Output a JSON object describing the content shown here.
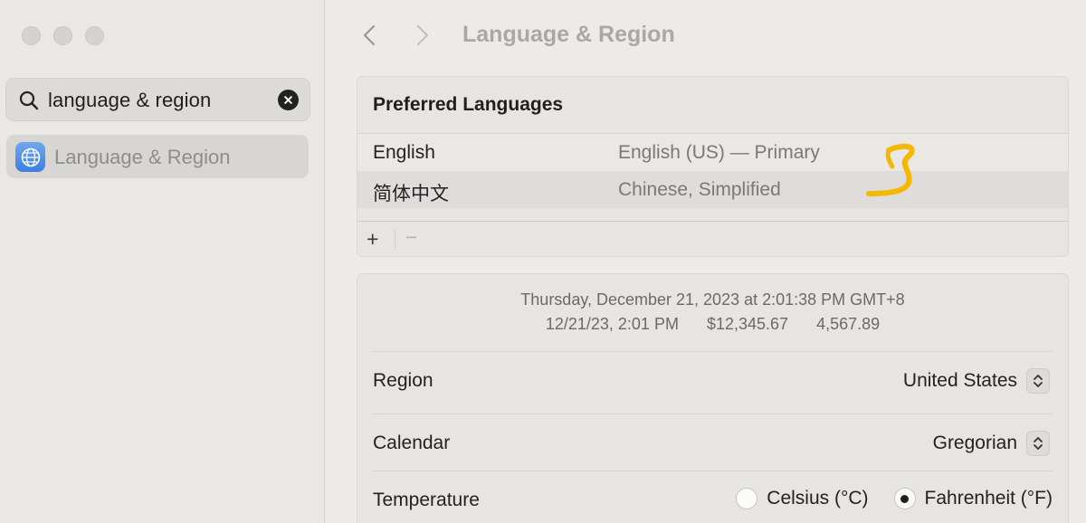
{
  "window": {
    "title": "Language & Region"
  },
  "sidebar": {
    "search": {
      "value": "language & region",
      "placeholder": "Search"
    },
    "items": [
      {
        "label": "Language & Region",
        "icon": "globe-icon",
        "selected": true
      }
    ]
  },
  "header": {
    "title": "Language & Region",
    "back_icon": "chevron-left-icon",
    "forward_icon": "chevron-right-icon"
  },
  "preferred_languages": {
    "title": "Preferred Languages",
    "languages": [
      {
        "name": "English",
        "description": "English (US) — Primary"
      },
      {
        "name": "简体中文",
        "description": "Chinese, Simplified"
      }
    ],
    "add_label": "+",
    "remove_label": "−"
  },
  "format_preview": {
    "line1": "Thursday, December 21, 2023 at 2:01:38 PM GMT+8",
    "date_short": "12/21/23, 2:01 PM",
    "currency": "$12,345.67",
    "number": "4,567.89"
  },
  "settings": {
    "region": {
      "label": "Region",
      "value": "United States"
    },
    "calendar": {
      "label": "Calendar",
      "value": "Gregorian"
    },
    "temperature": {
      "label": "Temperature",
      "options": [
        {
          "label": "Celsius (°C)",
          "selected": false
        },
        {
          "label": "Fahrenheit (°F)",
          "selected": true
        }
      ]
    }
  },
  "colors": {
    "accent_annotation": "#f5b800",
    "globe_blue": "#3c7fe0"
  }
}
